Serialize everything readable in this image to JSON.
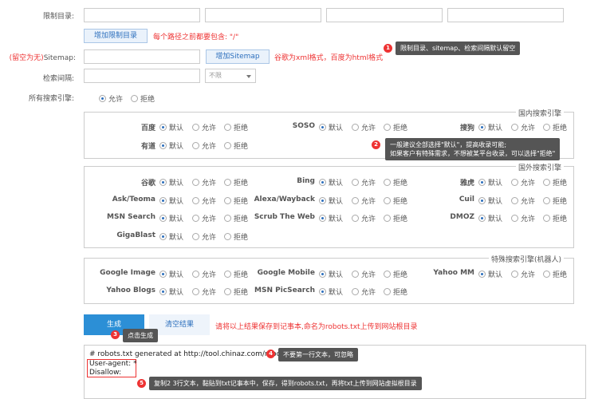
{
  "form": {
    "restrict_label": "限制目录:",
    "add_restrict_button": "增加限制目录",
    "restrict_note": "每个路径之前都要包含: \"/\"",
    "sitemap_label_red": "(留空为无)",
    "sitemap_label": "Sitemap:",
    "add_sitemap_button": "增加Sitemap",
    "sitemap_note": "谷歌为xml格式，百度为html格式",
    "interval_label": "检索间隔:",
    "interval_value": "不限",
    "all_engines_label": "所有搜索引擎:",
    "allow": "允许",
    "deny": "拒绝",
    "default": "默认"
  },
  "tips": [
    {
      "n": "1",
      "text": "限制目录、sitemap、检索间隔默认留空"
    },
    {
      "n": "2",
      "line1": "一般建议全部选择\"默认\"，提高收录可能;",
      "line2": "如果客户有特殊需求，不想被某平台收录，可以选择\"拒绝\""
    },
    {
      "n": "3",
      "text": "点击生成"
    },
    {
      "n": "4",
      "text": "不要第一行文本，可忽略"
    },
    {
      "n": "5",
      "text": "复制2 3行文本，黏贴到txt记事本中，保存，得到robots.txt，再将txt上传到网站虚拟根目录"
    }
  ],
  "domestic": {
    "legend": "国内搜索引擎",
    "engines": [
      "百度",
      "SOSO",
      "搜狗",
      "有道"
    ]
  },
  "foreign": {
    "legend": "国外搜索引擎",
    "engines": [
      "谷歌",
      "Bing",
      "雅虎",
      "Ask/Teoma",
      "Alexa/Wayback",
      "Cuil",
      "MSN Search",
      "Scrub The Web",
      "DMOZ",
      "GigaBlast"
    ]
  },
  "special": {
    "legend": "特殊搜索引擎(机器人)",
    "engines": [
      "Google Image",
      "Google Mobile",
      "Yahoo MM",
      "Yahoo Blogs",
      "MSN PicSearch"
    ]
  },
  "actions": {
    "generate": "生成",
    "clear": "清空结果",
    "note": "请将以上结果保存到记事本,命名为robots.txt上传到网站根目录"
  },
  "output": {
    "line1": "# robots.txt generated at http://tool.chinaz.com/robots/",
    "line2": "User-agent: *",
    "line3": "Disallow:"
  }
}
